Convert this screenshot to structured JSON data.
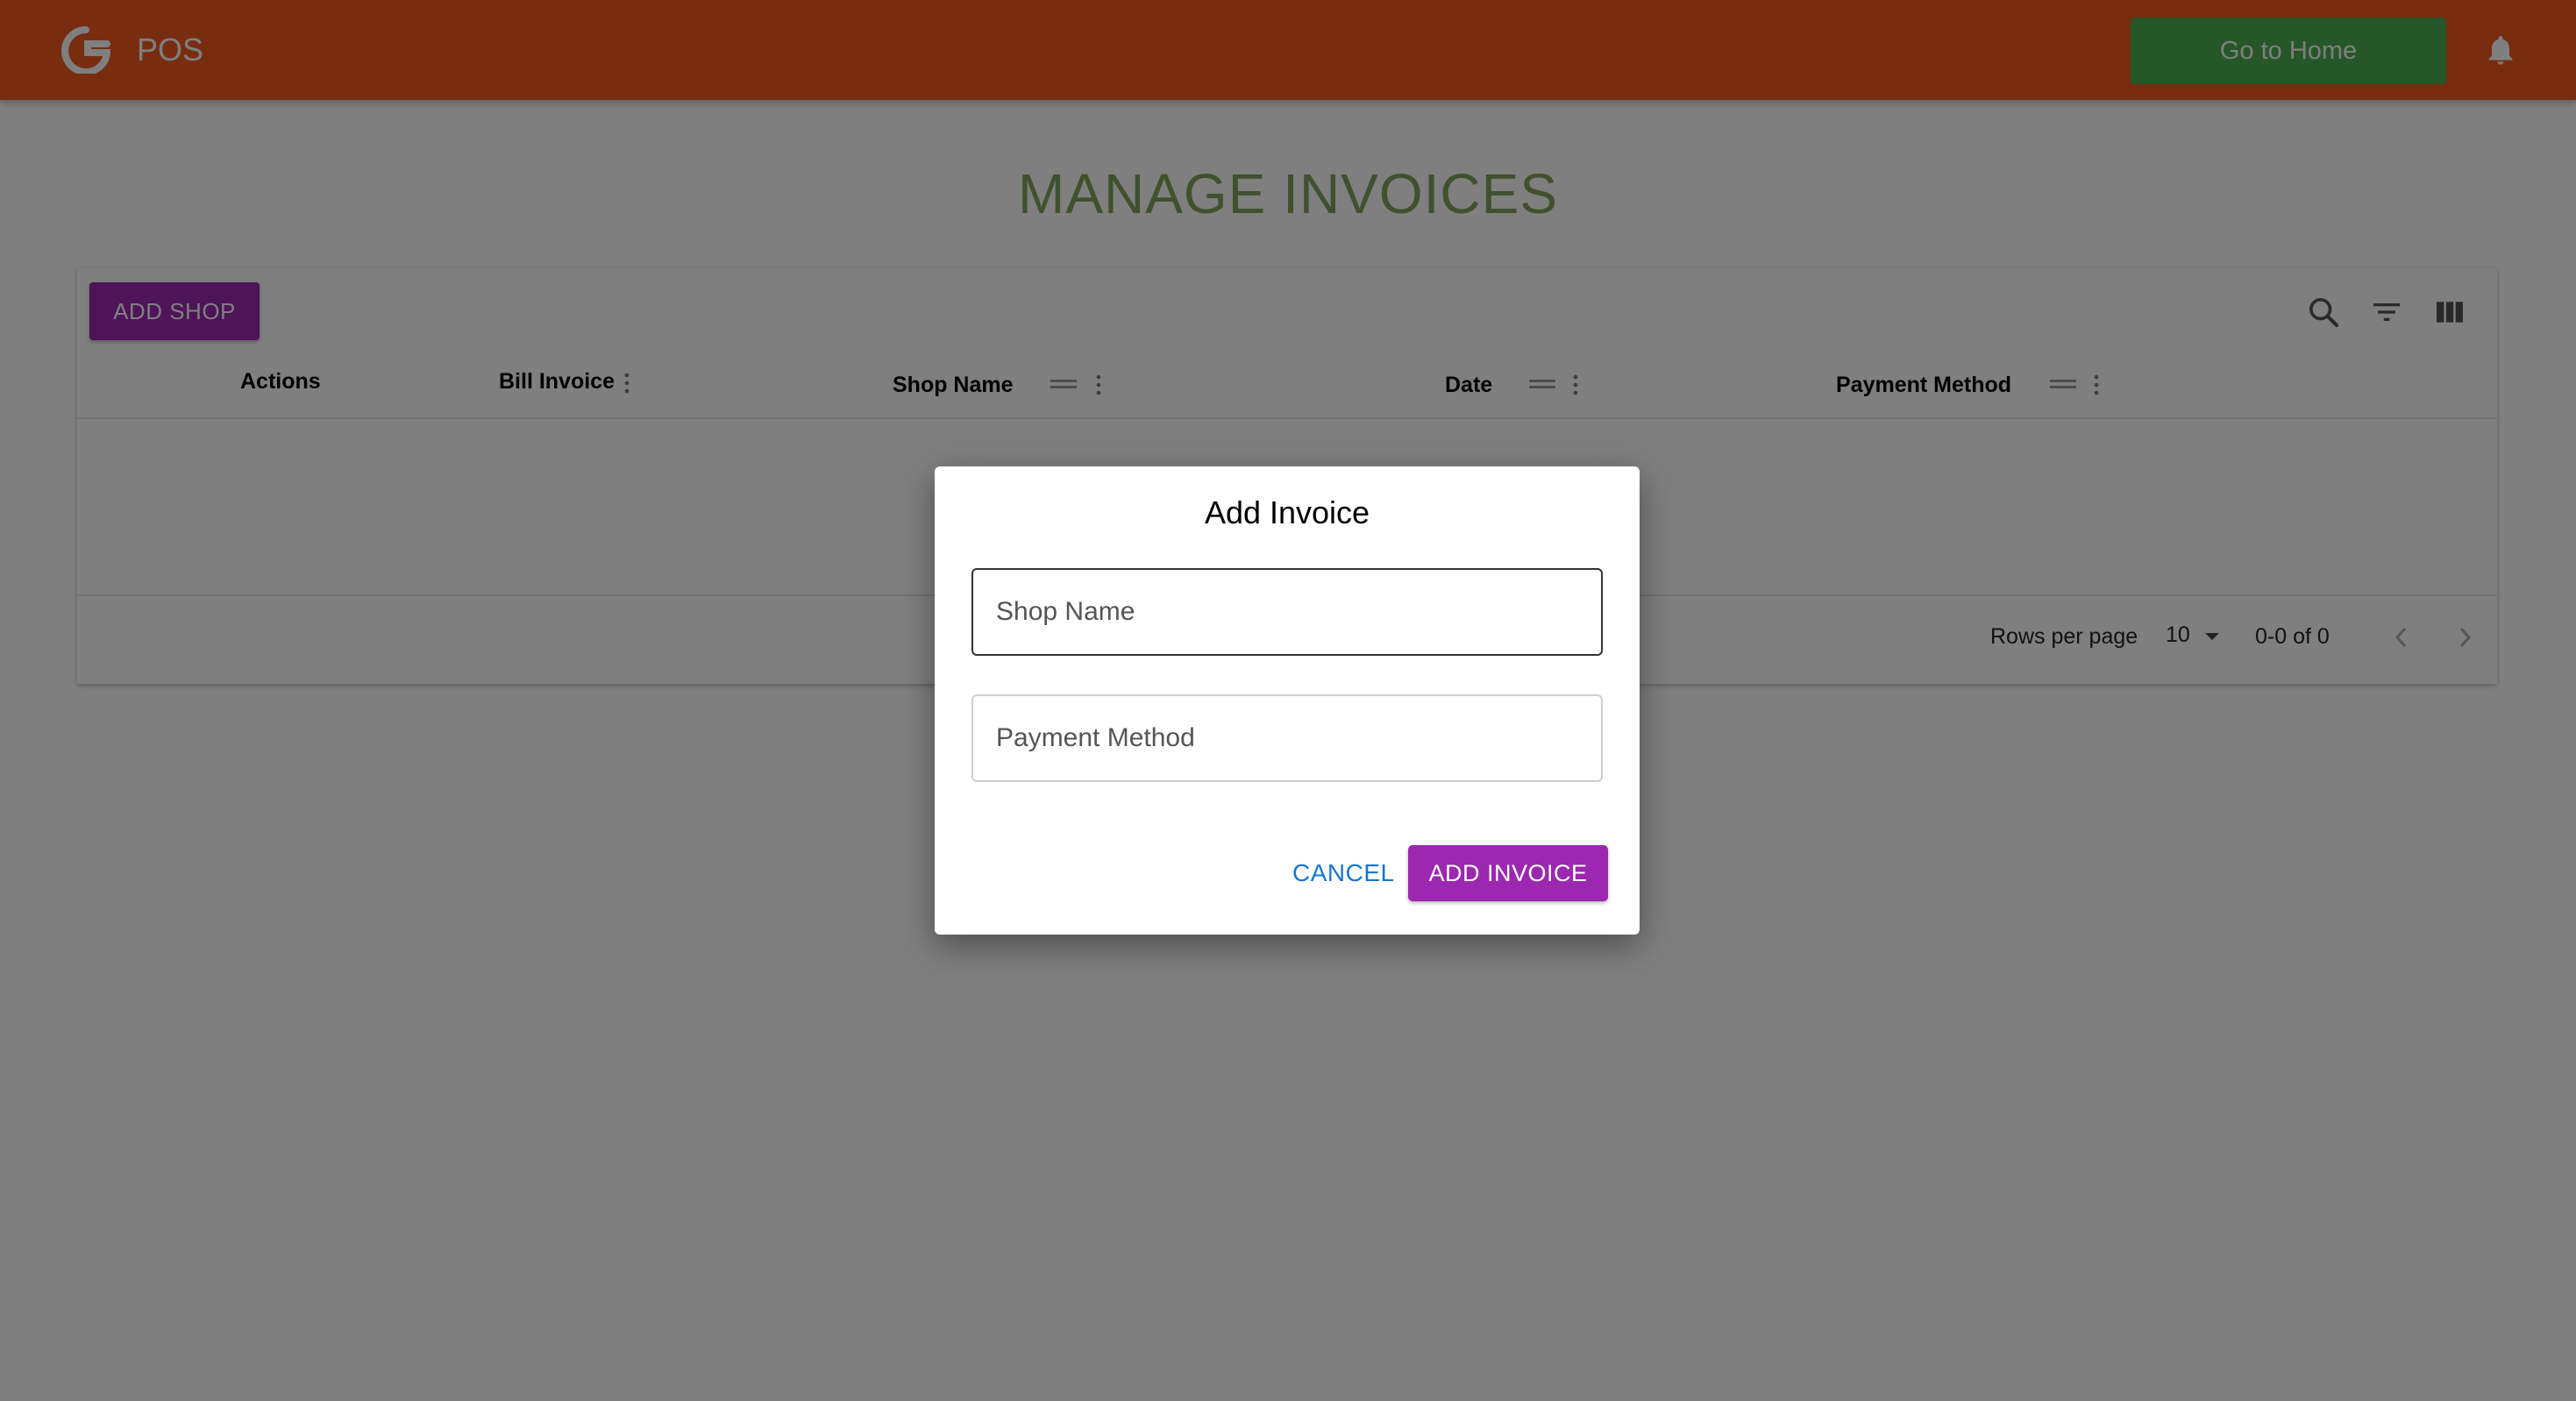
{
  "appbar": {
    "title": "POS",
    "home_button": "Go to Home",
    "logo_icon": "g-logo-icon",
    "bell_icon": "bell-icon",
    "color": "#f05a22"
  },
  "page": {
    "title": "MANAGE INVOICES"
  },
  "grid": {
    "add_button": "ADD SHOP",
    "toolbar_icons": [
      "search-icon",
      "filter-icon",
      "columns-icon"
    ],
    "columns": [
      {
        "label": "Actions"
      },
      {
        "label": "Bill Invoice"
      },
      {
        "label": "Shop Name"
      },
      {
        "label": "Date"
      },
      {
        "label": "Payment Method"
      }
    ],
    "rows": [],
    "footer": {
      "rows_per_page_label": "Rows per page",
      "rows_per_page_value": "10",
      "range": "0-0 of 0"
    }
  },
  "dialog": {
    "title": "Add Invoice",
    "shop_name_placeholder": "Shop Name",
    "payment_method_placeholder": "Payment Method",
    "cancel_label": "CANCEL",
    "submit_label": "ADD INVOICE"
  },
  "colors": {
    "primary_purple": "#9c27b0",
    "home_green": "#4caf50",
    "title_green": "#7ea35a",
    "link_blue": "#1976d2"
  }
}
